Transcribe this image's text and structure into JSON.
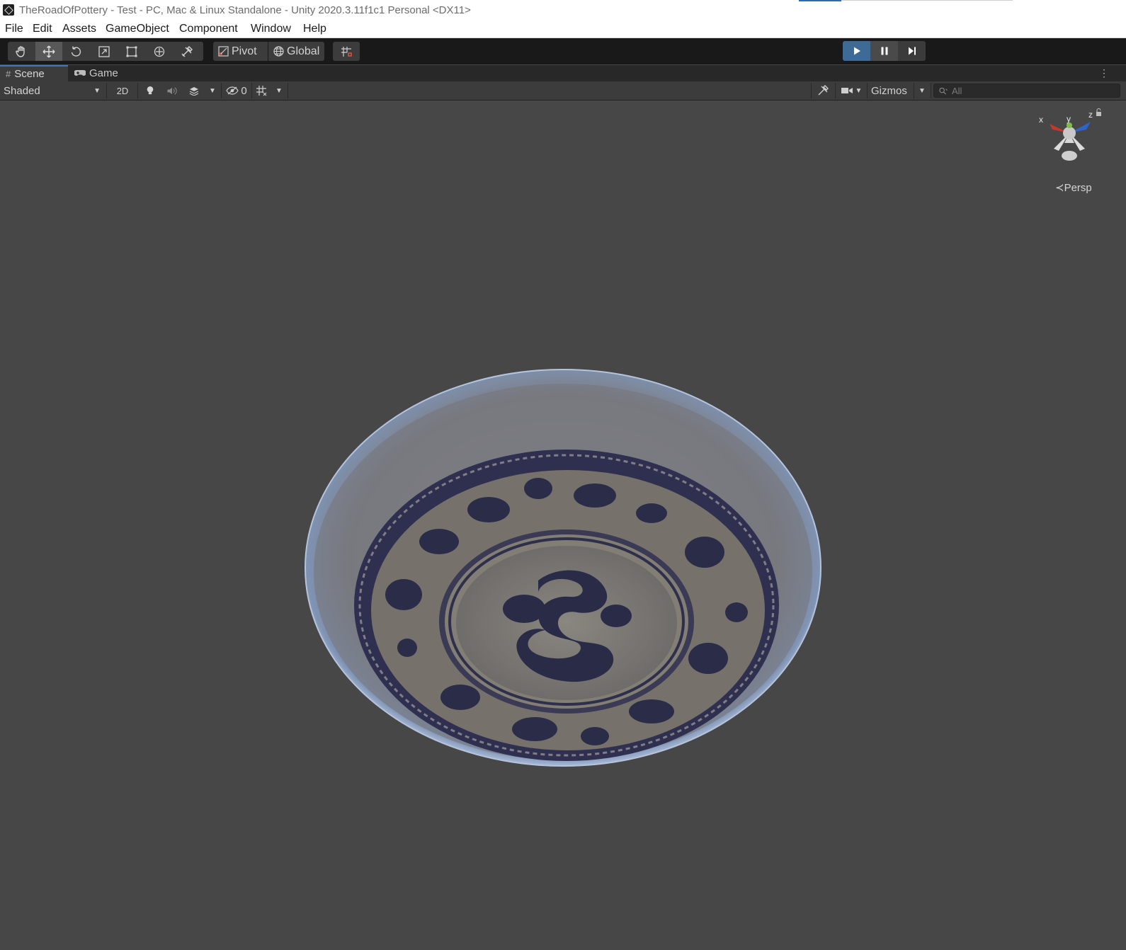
{
  "window": {
    "title": "TheRoadOfPottery - Test - PC, Mac & Linux Standalone - Unity 2020.3.11f1c1 Personal <DX11>"
  },
  "menu": [
    "File",
    "Edit",
    "Assets",
    "GameObject",
    "Component",
    "Window",
    "Help"
  ],
  "toolbar": {
    "tools": [
      "hand-tool",
      "move-tool",
      "rotate-tool",
      "scale-tool",
      "rect-tool",
      "transform-tool",
      "custom-tool"
    ],
    "active_tool": "move-tool",
    "pivot_label": "Pivot",
    "global_label": "Global",
    "play_active": true
  },
  "tabs": {
    "scene_label": "Scene",
    "game_label": "Game"
  },
  "scene_toolbar": {
    "shading_mode": "Shaded",
    "two_d_label": "2D",
    "hidden_count": "0",
    "gizmos_label": "Gizmos",
    "search_placeholder": "All"
  },
  "viewport": {
    "gizmo_axes": {
      "x": "x",
      "y": "y",
      "z": "z"
    },
    "projection_label": "Persp",
    "background_color": "#474747"
  },
  "colors": {
    "play_active": "#3e6a97",
    "tab_underline": "#3a79bb",
    "axis_x": "#c0392b",
    "axis_y": "#7fbf3f",
    "axis_z": "#2f63c8",
    "glaze_blue": "#2e2f4a"
  }
}
